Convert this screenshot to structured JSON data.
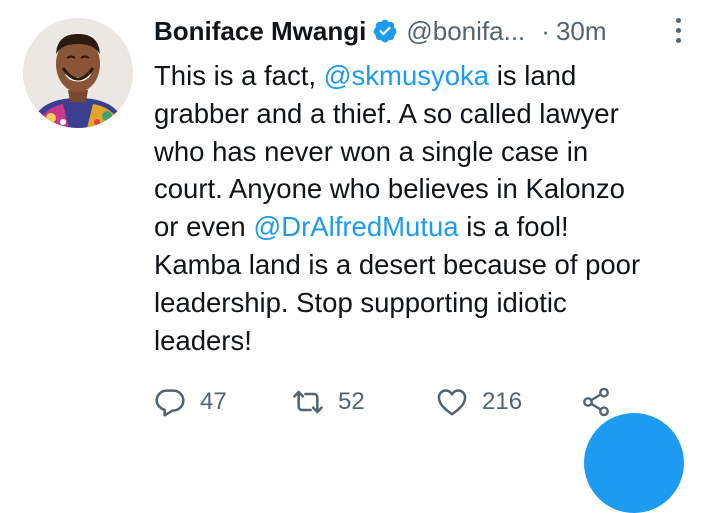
{
  "tweet": {
    "author_name": "Boniface Mwangi",
    "handle": "@bonifa...",
    "separator": "·",
    "time": "30m",
    "body_lines": [
      [
        {
          "t": "This is a fact, "
        },
        {
          "t": "@skmusyoka",
          "m": true
        },
        {
          "t": " is land"
        }
      ],
      [
        {
          "t": "grabber and a thief. A so called lawyer"
        }
      ],
      [
        {
          "t": "who has never won a single case in"
        }
      ],
      [
        {
          "t": "court. Anyone who believes in Kalonzo"
        }
      ],
      [
        {
          "t": "or even "
        },
        {
          "t": "@DrAlfredMutua",
          "m": true
        },
        {
          "t": " is a fool!"
        }
      ],
      [
        {
          "t": "Kamba land is a desert because of poor"
        }
      ],
      [
        {
          "t": "leadership. Stop supporting idiotic"
        }
      ],
      [
        {
          "t": "leaders!"
        }
      ]
    ],
    "replies": "47",
    "retweets": "52",
    "likes": "216"
  },
  "icons": {
    "verified": "verified-badge-icon",
    "more": "more-vertical-icon",
    "reply": "reply-icon",
    "retweet": "retweet-icon",
    "like": "heart-icon",
    "share": "share-icon"
  },
  "colors": {
    "accent": "#1d9bf0",
    "text": "#0f1419",
    "muted": "#536471"
  }
}
